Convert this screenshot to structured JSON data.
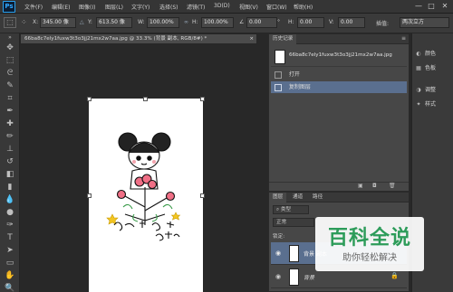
{
  "app": {
    "logo": "Ps"
  },
  "menu": [
    "文件(F)",
    "编辑(E)",
    "图像(I)",
    "图层(L)",
    "文字(Y)",
    "选择(S)",
    "滤镜(T)",
    "3D(D)",
    "视图(V)",
    "窗口(W)",
    "帮助(H)"
  ],
  "window_controls": [
    "—",
    "□",
    "✕"
  ],
  "options": {
    "x_label": "X:",
    "x_value": "345.00 像",
    "y_label": "Y:",
    "y_value": "613.50 像",
    "w_label": "W:",
    "w_value": "100.00%",
    "h_label": "H:",
    "h_value": "100.00%",
    "angle_value": "0.00",
    "hskew_label": "H:",
    "hskew_value": "0.00",
    "vskew_label": "V:",
    "vskew_value": "0.00",
    "interp_label": "插值:",
    "interp_value": "两次立方"
  },
  "document": {
    "tab_title": "66ba8c7ely1fuxw3t3o3jj21mx2w7aa.jpg @ 33.3% (背景 副本, RGB/8#) *",
    "tab_close": "×"
  },
  "history_panel": {
    "tab": "历史记录",
    "snapshot_name": "66ba8c7ely1fuxw3t3o3jj21mx2w7aa.jpg",
    "items": [
      "打开",
      "复制图层"
    ]
  },
  "layers_panel": {
    "tabs": [
      "图层",
      "通道",
      "路径"
    ],
    "filter_label": "类型",
    "blend_mode": "正常",
    "lock_label": "锁定:",
    "layers": [
      {
        "name": "背景 副本"
      },
      {
        "name": "背景"
      }
    ]
  },
  "right_panels": [
    {
      "icon": "color-icon",
      "label": "颜色"
    },
    {
      "icon": "swatches-icon",
      "label": "色板"
    },
    {
      "icon": "adjustments-icon",
      "label": "调整"
    },
    {
      "icon": "styles-icon",
      "label": "样式"
    }
  ],
  "watermark": {
    "title": "百科全说",
    "subtitle": "助你轻松解决"
  },
  "colors": {
    "accent": "#31a8ff",
    "watermark_green": "#2d9c5a",
    "selected_row": "#5a6f8f"
  }
}
